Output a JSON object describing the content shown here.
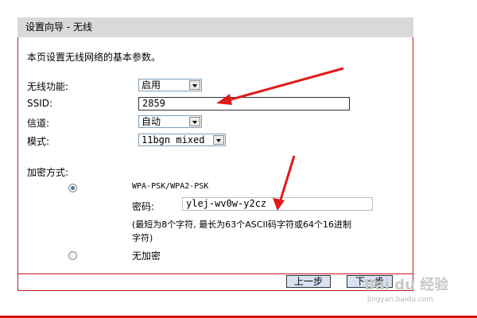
{
  "wizard": {
    "title": "设置向导 - 无线",
    "intro": "本页设置无线网络的基本参数。"
  },
  "form": {
    "wireless_label": "无线功能:",
    "wireless_value": "启用",
    "ssid_label": "SSID:",
    "ssid_value": "2859",
    "channel_label": "信道:",
    "channel_value": "自动",
    "mode_label": "模式:",
    "mode_value": "11bgn mixed",
    "encryption_label": "加密方式:",
    "wpa_option_label": "WPA-PSK/WPA2-PSK",
    "wpa_selected": true,
    "password_label": "密码:",
    "password_value": "ylej-wv0w-y2cz",
    "password_note_line1": "(最短为8个字符, 最长为63个ASCII码字符或64个16进制",
    "password_note_line2": "字符)",
    "no_encryption_label": "无加密",
    "no_encryption_selected": false
  },
  "buttons": {
    "prev_label": "上一步",
    "next_label": "下一步"
  },
  "watermark": {
    "main": "Bai du 经验",
    "sub": "jingyan.baidu.com"
  },
  "colors": {
    "accent_red": "#c5161d",
    "arrow_red": "#e11b1b",
    "titlebar_bg": "#d9d9d9"
  }
}
